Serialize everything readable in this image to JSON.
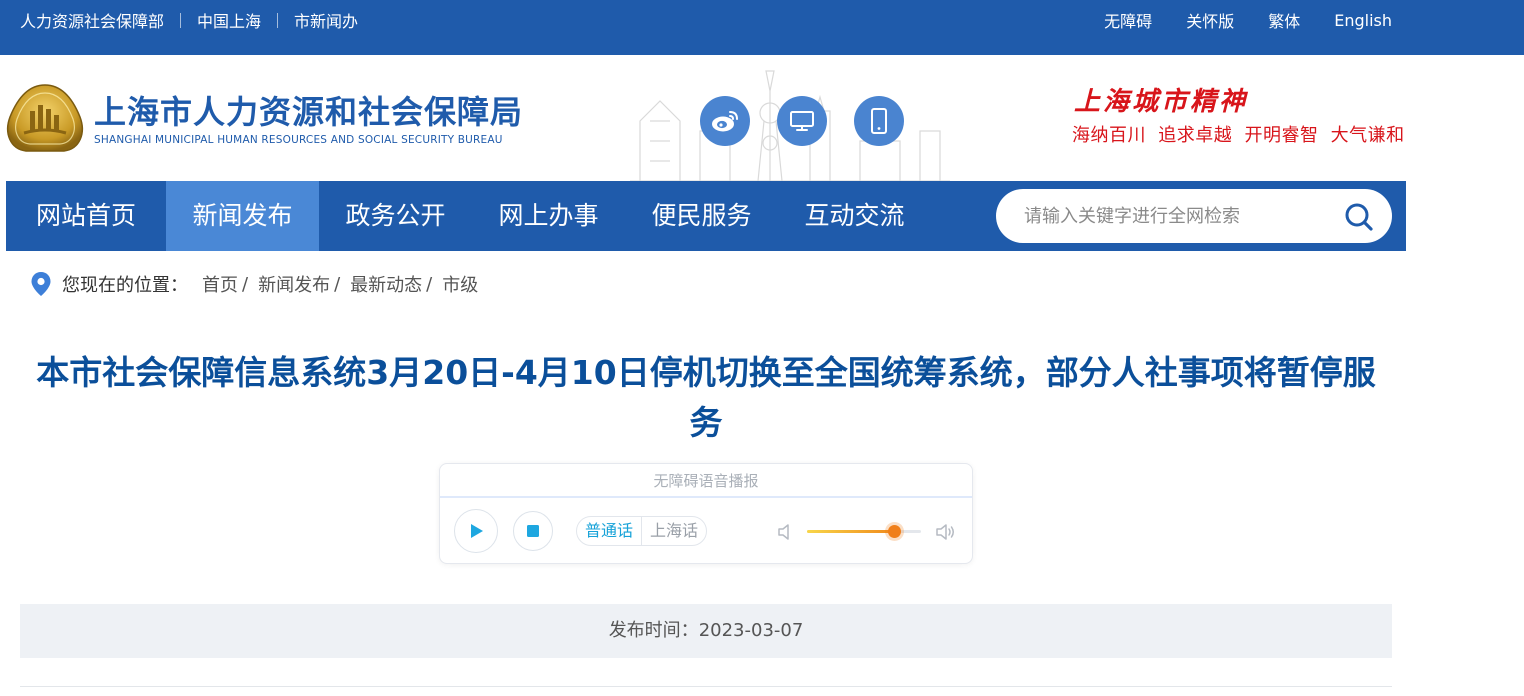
{
  "topbar": {
    "links": [
      "人力资源社会保障部",
      "中国上海",
      "市新闻办"
    ],
    "tools": [
      "无障碍",
      "关怀版",
      "繁体",
      "English"
    ]
  },
  "header": {
    "site_name": "上海市人力资源和社会保障局",
    "site_name_en": "SHANGHAI MUNICIPAL HUMAN RESOURCES AND SOCIAL SECURITY BUREAU",
    "icons": [
      "weibo-icon",
      "desktop-icon",
      "mobile-icon"
    ],
    "slogan_title": "上海城市精神",
    "slogan_sub": "海纳百川 追求卓越 开明睿智 大气谦和"
  },
  "nav": {
    "items": [
      "网站首页",
      "新闻发布",
      "政务公开",
      "网上办事",
      "便民服务",
      "互动交流"
    ],
    "active_index": 1,
    "search_placeholder": "请输入关键字进行全网检索"
  },
  "breadcrumb": {
    "label": "您现在的位置：",
    "items": [
      "首页",
      "新闻发布",
      "最新动态",
      "市级"
    ],
    "separator": "/"
  },
  "article": {
    "title": "本市社会保障信息系统3月20日-4月10日停机切换至全国统筹系统，部分人社事项将暂停服务",
    "publish_label": "发布时间：",
    "publish_date": "2023-03-07"
  },
  "player": {
    "title": "无障碍语音播报",
    "lang_options": [
      "普通话",
      "上海话"
    ],
    "selected_lang": "普通话",
    "volume_fraction": 0.76
  },
  "colors": {
    "brand_blue": "#1f5bab",
    "nav_active": "#4a88d6",
    "title_blue": "#0b4f9a",
    "slogan_red": "#d8151b",
    "accent_orange": "#f07f1a",
    "lang_active": "#16a2d8"
  }
}
